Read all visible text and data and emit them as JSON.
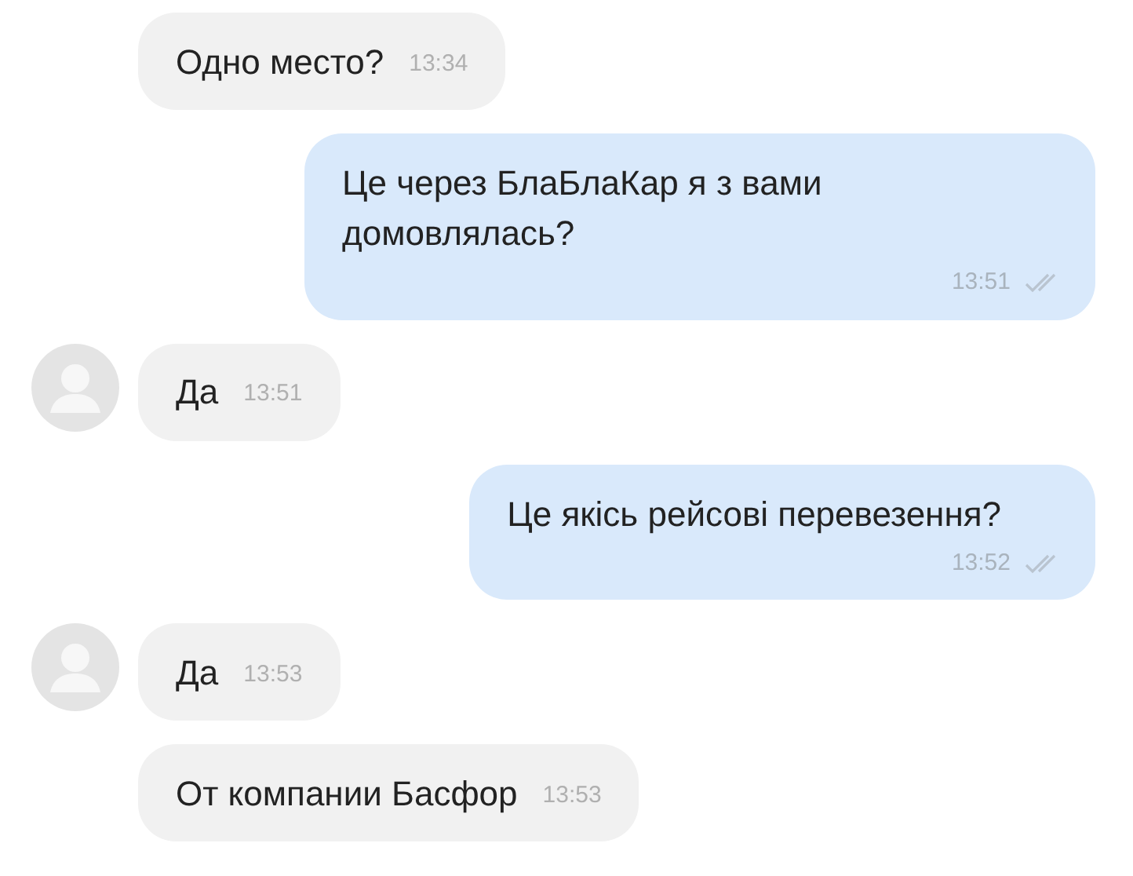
{
  "messages": [
    {
      "kind": "incoming",
      "avatar": false,
      "text": "Одно место?",
      "time": "13:34"
    },
    {
      "kind": "outgoing",
      "text": "Це через БлаБлаКар я з вами домовлялась?",
      "time": "13:51",
      "read": true
    },
    {
      "kind": "incoming",
      "avatar": true,
      "text": "Да",
      "time": "13:51"
    },
    {
      "kind": "outgoing",
      "text": "Це якісь рейсові перевезення?",
      "time": "13:52",
      "read": true
    },
    {
      "kind": "incoming",
      "avatar": true,
      "text": "Да",
      "time": "13:53"
    },
    {
      "kind": "incoming",
      "avatar": false,
      "text": "От компании Басфор",
      "time": "13:53"
    }
  ]
}
